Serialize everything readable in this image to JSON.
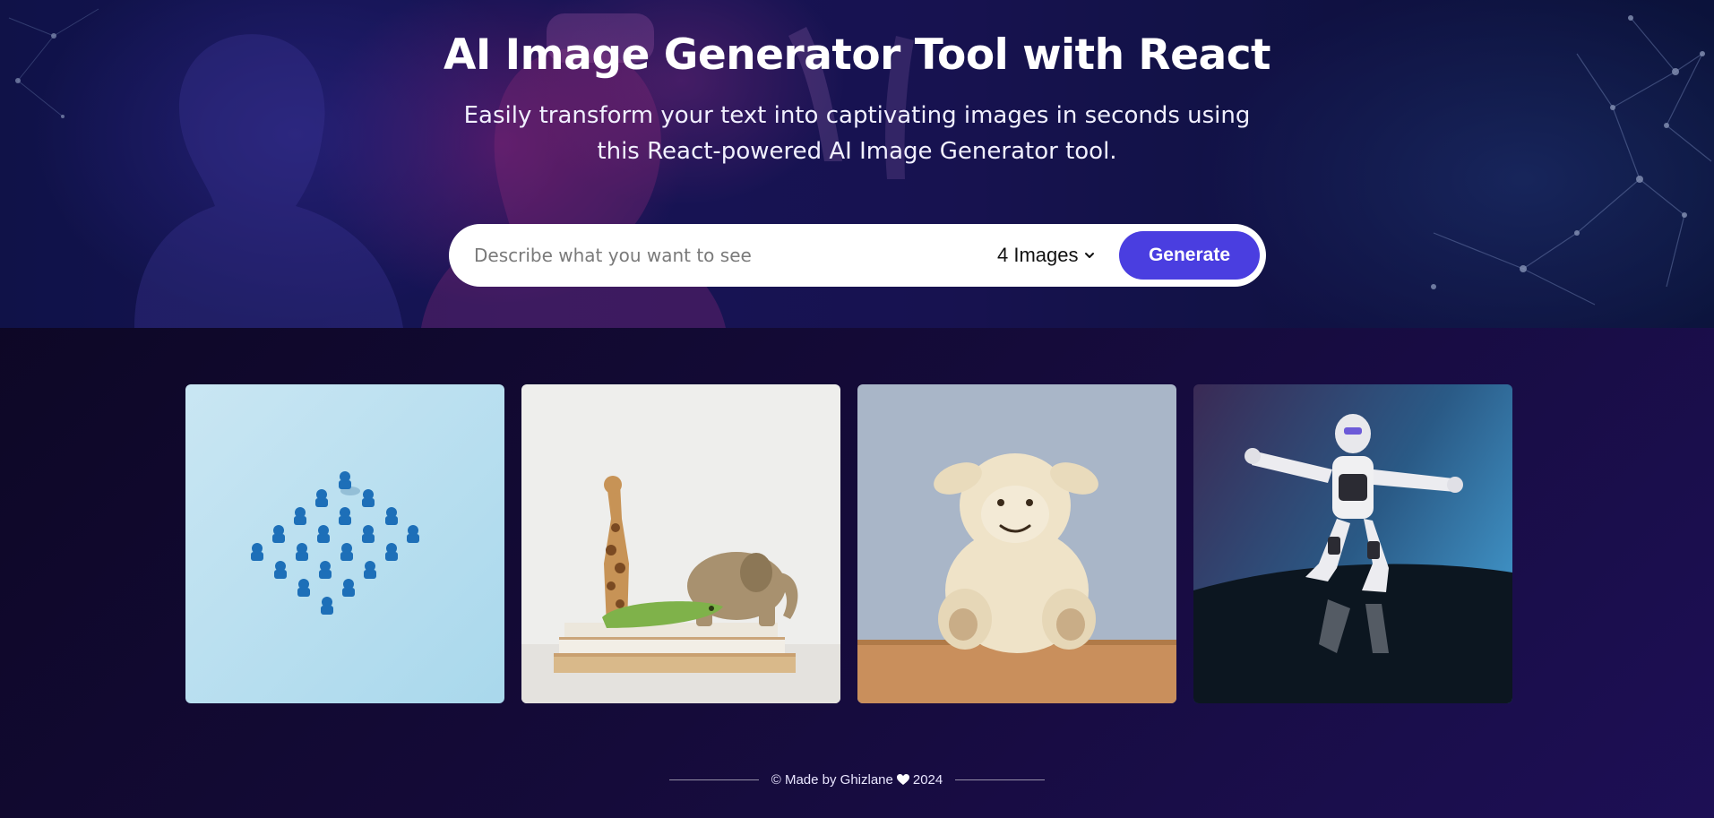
{
  "hero": {
    "title": "AI Image Generator Tool with React",
    "subtitle": "Easily transform your text into captivating images in seconds using this React-powered AI Image Generator tool."
  },
  "form": {
    "placeholder": "Describe what you want to see",
    "value": "",
    "count_selected": "4 Images",
    "generate_label": "Generate"
  },
  "gallery": {
    "images": [
      {
        "name": "blue-pawns-image",
        "icon": "blue-game-pieces"
      },
      {
        "name": "wooden-toys-image",
        "icon": "wooden-animal-toys"
      },
      {
        "name": "plush-sheep-image",
        "icon": "plush-toy"
      },
      {
        "name": "robot-image",
        "icon": "dancing-robot"
      }
    ]
  },
  "footer": {
    "made_by": "© Made by Ghizlane",
    "year": "2024",
    "icon": "heart-icon"
  },
  "colors": {
    "accent": "#4a3ee0",
    "background_dark": "#0b0620",
    "background_light": "#1d0f55"
  }
}
